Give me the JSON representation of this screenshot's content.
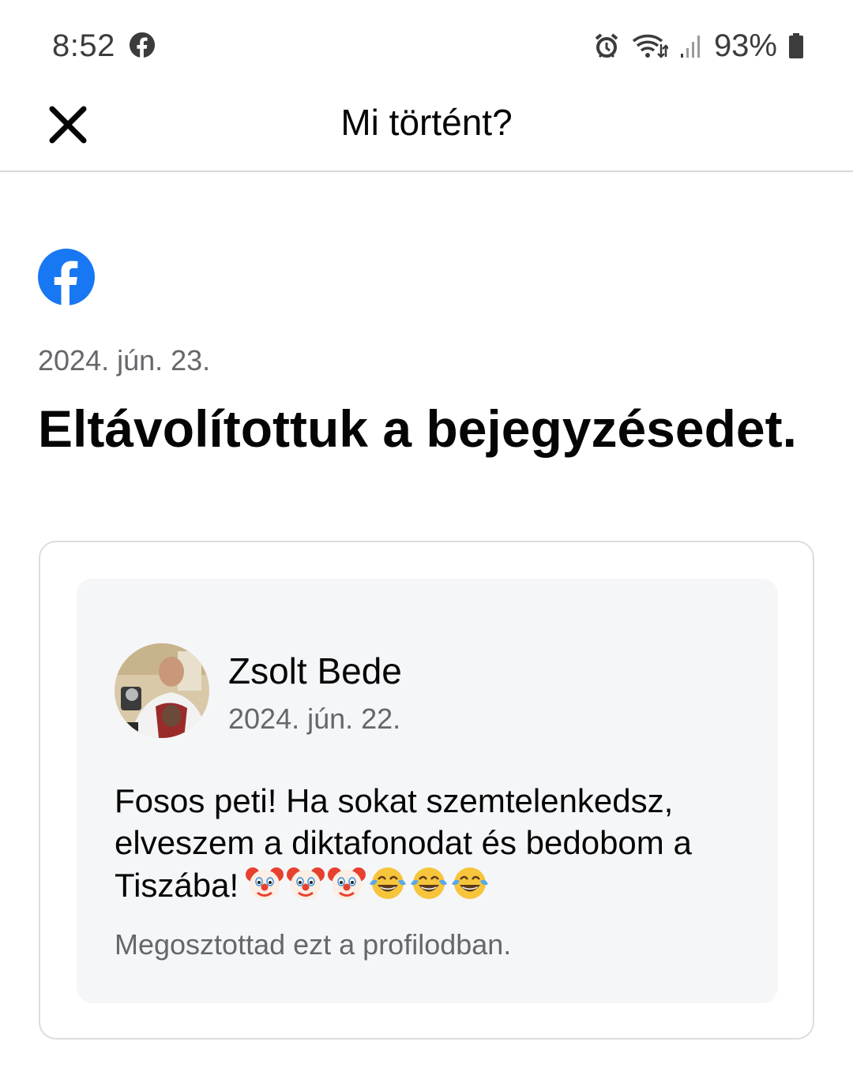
{
  "status_bar": {
    "time": "8:52",
    "battery": "93%",
    "icons": [
      "facebook-icon",
      "alarm-icon",
      "wifi-icon",
      "signal-icon",
      "battery-icon"
    ]
  },
  "header": {
    "title": "Mi történt?",
    "close_icon": "close-icon"
  },
  "notice": {
    "date": "2024. jún. 23.",
    "title": "Eltávolítottuk a bejegyzésedet."
  },
  "post": {
    "author": "Zsolt Bede",
    "date": "2024. jún. 22.",
    "text": "Fosos peti! Ha sokat szemtelenkedsz, elveszem a diktafonodat és bedobom a Tiszába!",
    "emojis": [
      "clown-face",
      "clown-face",
      "clown-face",
      "tears-of-joy",
      "tears-of-joy",
      "tears-of-joy"
    ],
    "footer": "Megosztottad ezt a profilodban."
  },
  "colors": {
    "facebook_blue": "#1877f2",
    "secondary_text": "#65676b",
    "post_background": "#f5f6f8",
    "card_border": "#dadde1"
  }
}
